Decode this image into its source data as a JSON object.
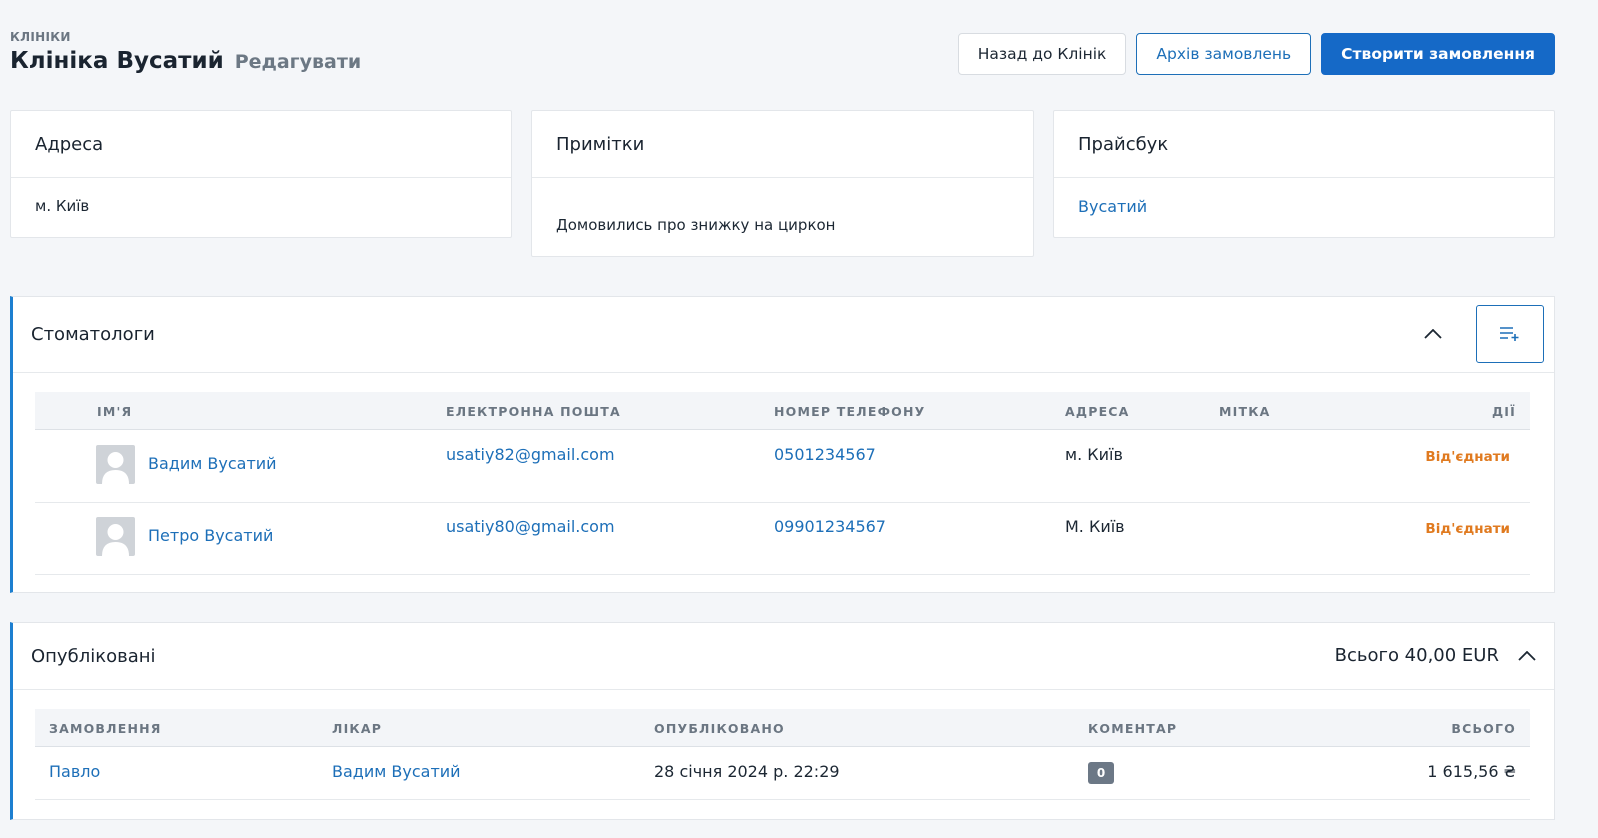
{
  "header": {
    "breadcrumb": "КЛІНІКИ",
    "title": "Клініка Вусатий",
    "edit_label": "Редагувати"
  },
  "actions": {
    "back_label": "Назад до Клінік",
    "archive_label": "Архів замовлень",
    "create_label": "Створити замовлення"
  },
  "cards": {
    "address": {
      "title": "Адреса",
      "value": "м. Київ"
    },
    "notes": {
      "title": "Примітки",
      "value": "Домовились про знижку на циркон"
    },
    "pricebook": {
      "title": "Прайсбук",
      "value": "Вусатий"
    }
  },
  "dentists": {
    "title": "Стоматологи",
    "columns": [
      "ІМ'Я",
      "ЕЛЕКТРОННА ПОШТА",
      "НОМЕР ТЕЛЕФОНУ",
      "АДРЕСА",
      "МІТКА",
      "ДІЇ"
    ],
    "rows": [
      {
        "name": "Вадим Вусатий",
        "email": "usatiy82@gmail.com",
        "phone": "0501234567",
        "address": "м. Київ",
        "tag": "",
        "action": "Від'єднати"
      },
      {
        "name": "Петро Вусатий",
        "email": "usatiy80@gmail.com",
        "phone": "09901234567",
        "address": "М. Київ",
        "tag": "",
        "action": "Від'єднати"
      }
    ]
  },
  "published": {
    "title": "Опубліковані",
    "total": "Всього 40,00 EUR",
    "columns": [
      "ЗАМОВЛЕННЯ",
      "ЛІКАР",
      "ОПУБЛІКОВАНО",
      "КОМЕНТАР",
      "ВСЬОГО"
    ],
    "rows": [
      {
        "order": "Павло",
        "doctor": "Вадим Вусатий",
        "published": "28 січня 2024 р. 22:29",
        "comments": "0",
        "total": "1 615,56 ₴"
      }
    ]
  },
  "colors": {
    "primary": "#1569c7",
    "link": "#1d6fb8",
    "accent_border": "#1d7fd0",
    "warning": "#e07a1f",
    "background": "#f4f6f9"
  },
  "icons": {
    "collapse": "chevron-up-icon",
    "add_dentist": "playlist-add-icon",
    "avatar": "user-placeholder-icon"
  }
}
